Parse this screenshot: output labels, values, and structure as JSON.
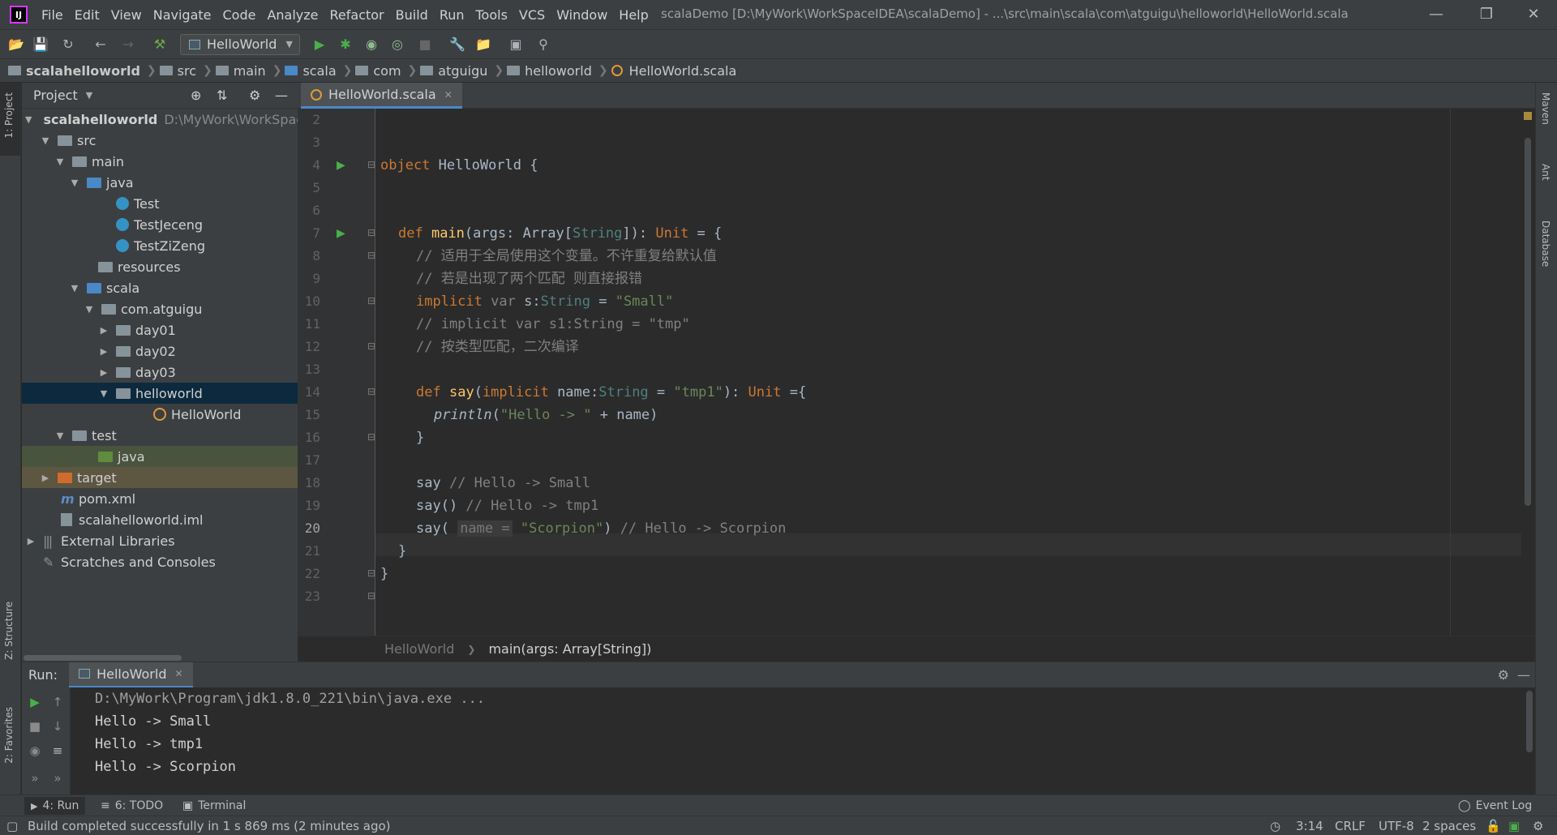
{
  "window": {
    "title": "scalaDemo [D:\\MyWork\\WorkSpaceIDEA\\scalaDemo] - ...\\src\\main\\scala\\com\\atguigu\\helloworld\\HelloWorld.scala",
    "menu": [
      "File",
      "Edit",
      "View",
      "Navigate",
      "Code",
      "Analyze",
      "Refactor",
      "Build",
      "Run",
      "Tools",
      "VCS",
      "Window",
      "Help"
    ]
  },
  "toolbar": {
    "run_config": "HelloWorld"
  },
  "breadcrumbs": [
    "scalahelloworld",
    "src",
    "main",
    "scala",
    "com",
    "atguigu",
    "helloworld",
    "HelloWorld.scala"
  ],
  "left_strip": {
    "project_tab": "1: Project",
    "structure_tab": "Z: Structure",
    "favorites_tab": "2: Favorites"
  },
  "right_strip": {
    "maven_tab": "Maven",
    "ant_tab": "Ant",
    "database_tab": "Database"
  },
  "project_panel": {
    "title": "Project",
    "tree": [
      {
        "label": "scalahelloworld",
        "extra": "D:\\MyWork\\WorkSpace"
      },
      {
        "label": "src"
      },
      {
        "label": "main"
      },
      {
        "label": "java"
      },
      {
        "label": "Test"
      },
      {
        "label": "TestJeceng"
      },
      {
        "label": "TestZiZeng"
      },
      {
        "label": "resources"
      },
      {
        "label": "scala"
      },
      {
        "label": "com.atguigu"
      },
      {
        "label": "day01"
      },
      {
        "label": "day02"
      },
      {
        "label": "day03"
      },
      {
        "label": "helloworld"
      },
      {
        "label": "HelloWorld"
      },
      {
        "label": "test"
      },
      {
        "label": "java"
      },
      {
        "label": "target"
      },
      {
        "label": "pom.xml"
      },
      {
        "label": "scalahelloworld.iml"
      },
      {
        "label": "External Libraries"
      },
      {
        "label": "Scratches and Consoles"
      }
    ]
  },
  "editor": {
    "tab": "HelloWorld.scala",
    "line_numbers": [
      "2",
      "3",
      "4",
      "5",
      "6",
      "7",
      "8",
      "9",
      "10",
      "11",
      "12",
      "13",
      "14",
      "15",
      "16",
      "17",
      "18",
      "19",
      "20",
      "21",
      "22",
      "23"
    ],
    "current_line": "20",
    "code": {
      "l4_kw": "object",
      "l4_rest": " HelloWorld {",
      "l7_kw": "def",
      "l7_fn": "main",
      "l7_a": "(args: Array[",
      "l7_t": "String",
      "l7_b": "]): ",
      "l7_unit": "Unit",
      "l7_c": " = {",
      "l8": "// 适用于全局使用这个变量。不许重复给默认值",
      "l9": "// 若是出现了两个匹配 则直接报错",
      "l10_kw": "implicit",
      "l10_var": " var ",
      "l10_id": "s:",
      "l10_t": "String",
      "l10_eq": " = ",
      "l10_str": "\"Small\"",
      "l11": "// implicit var s1:String = \"tmp\"",
      "l12": "// 按类型匹配，二次编译",
      "l14_kw": "def",
      "l14_fn": "say",
      "l14_a": "(",
      "l14_imp": "implicit",
      "l14_b": " name:",
      "l14_t": "String",
      "l14_c": " = ",
      "l14_str": "\"tmp1\"",
      "l14_d": "): ",
      "l14_unit": "Unit",
      "l14_e": " ={",
      "l15_fn": "println",
      "l15_a": "(",
      "l15_str": "\"Hello -> \"",
      "l15_b": " + name)",
      "l16": "}",
      "l18_a": "say ",
      "l18_cm": "// Hello -> Small",
      "l19_a": "say() ",
      "l19_cm": "// Hello -> tmp1",
      "l20_a": "say( ",
      "l20_hint": "name =",
      "l20_str": " \"Scorpion\"",
      "l20_b": ") ",
      "l20_cm": "// Hello -> Scorpion",
      "l21": "}",
      "l22": "}"
    },
    "breadcrumb_class": "HelloWorld",
    "breadcrumb_method": "main(args: Array[String])"
  },
  "run_panel": {
    "label": "Run:",
    "tab": "HelloWorld",
    "output": [
      "D:\\MyWork\\Program\\jdk1.8.0_221\\bin\\java.exe ...",
      "Hello -> Small",
      "Hello -> tmp1",
      "Hello -> Scorpion"
    ]
  },
  "bottom_tabs": {
    "run": "4: Run",
    "todo": "6: TODO",
    "terminal": "Terminal",
    "event_log": "Event Log"
  },
  "status": {
    "message": "Build completed successfully in 1 s 869 ms (2 minutes ago)",
    "position": "3:14",
    "line_sep": "CRLF",
    "encoding": "UTF-8",
    "indent": "2 spaces"
  },
  "colors": {
    "keyword": "#cc7832",
    "function": "#ffc66d",
    "string": "#6a8759",
    "comment": "#808080",
    "selection": "#0d293e"
  }
}
